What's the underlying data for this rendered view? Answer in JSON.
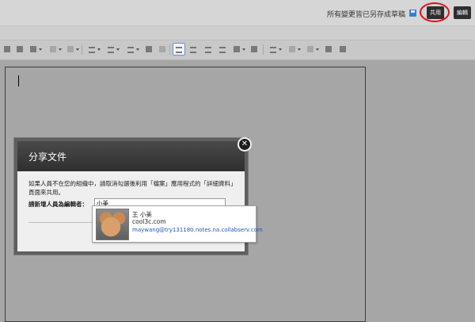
{
  "header": {
    "status_text": "所有變更皆已另存成草稿",
    "share_label": "共用",
    "edit_label": "編輯"
  },
  "dialog": {
    "title": "分享文件",
    "close_glyph": "✕",
    "info_text": "如果人員不在您的組織中，請取消勾選後利用「檔案」應用程式的「詳細資料」頁面來共用。",
    "field_label": "請新增人員為編輯者：",
    "input_value": "小美"
  },
  "suggestion": {
    "name": "王 小美",
    "id": "cool3c.com",
    "email": "maywang@try131180.notes.na.collabserv.com"
  },
  "colors": {
    "share_highlight": "#e0101a",
    "link": "#2254b8"
  }
}
